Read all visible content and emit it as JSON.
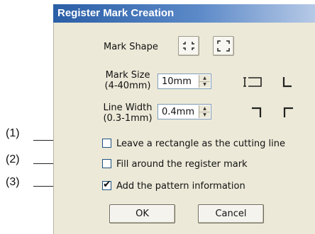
{
  "dialog": {
    "title": "Register Mark Creation",
    "mark_shape_label": "Mark Shape",
    "mark_size_label_1": "Mark Size",
    "mark_size_label_2": "(4-40mm)",
    "mark_size_value": "10mm",
    "line_width_label_1": "Line Width",
    "line_width_label_2": "(0.3-1mm)",
    "line_width_value": "0.4mm",
    "checkboxes": [
      {
        "label": "Leave a rectangle as the cutting line",
        "checked": false
      },
      {
        "label": "Fill around the register mark",
        "checked": false
      },
      {
        "label": "Add the pattern information",
        "checked": true
      }
    ],
    "ok_label": "OK",
    "cancel_label": "Cancel",
    "check_glyph": "✔"
  },
  "callouts": [
    "(1)",
    "(2)",
    "(3)"
  ],
  "icons": {
    "shape_option_1": "corner-ticks-inward-icon",
    "shape_option_2": "corner-brackets-icon",
    "size_indicator": "size-dimension-icon",
    "mark_tl": "corner-mark-top-left-icon",
    "mark_tr": "corner-mark-top-right-icon",
    "mark_bl": "corner-mark-bottom-left-icon",
    "mark_br": "corner-mark-bottom-right-icon"
  },
  "colors": {
    "title_gradient_start": "#2a5ea6",
    "title_gradient_end": "#b6c9e6",
    "dialog_bg": "#ece9d8"
  }
}
